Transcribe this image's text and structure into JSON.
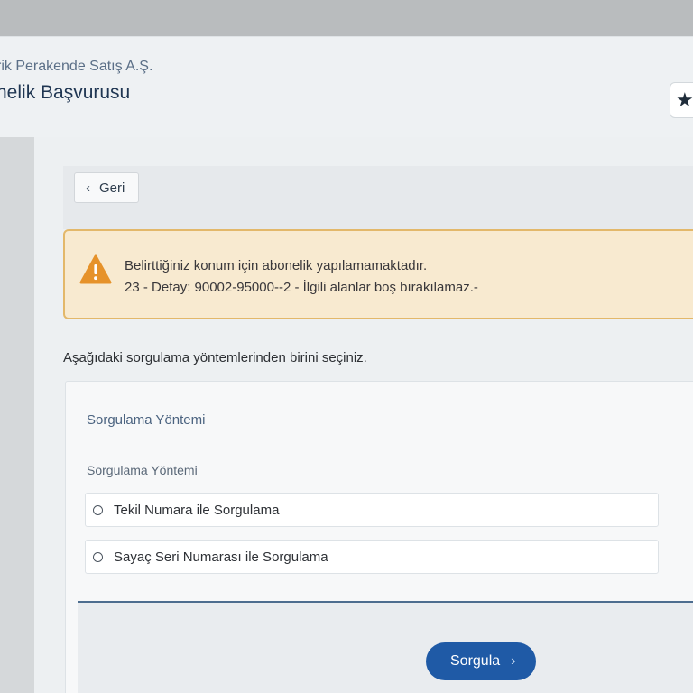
{
  "header": {
    "company": "rik Perakende Satış A.Ş.",
    "app_title": "nelik Başvurusu",
    "favorite_icon": "star-icon"
  },
  "back_button": {
    "label": "Geri",
    "icon": "chevron-left-icon"
  },
  "alert": {
    "icon": "warning-icon",
    "line1": "Belirttiğiniz konum için abonelik yapılamamaktadır.",
    "line2": "23 - Detay: 90002-95000--2 - İlgili alanlar boş bırakılamaz.-",
    "colors": {
      "background": "#f8ead0",
      "border": "#e3b86a",
      "icon": "#e6922a"
    }
  },
  "instruction": "Aşağıdaki sorgulama yöntemlerinden birini seçiniz.",
  "query_card": {
    "title": "Sorgulama Yöntemi",
    "field_label": "Sorgulama Yöntemi",
    "options": [
      {
        "label": "Tekil Numara ile Sorgulama",
        "selected": false
      },
      {
        "label": "Sayaç Seri Numarası ile Sorgulama",
        "selected": false
      }
    ]
  },
  "submit_button": {
    "label": "Sorgula",
    "icon": "chevron-right-icon",
    "color": "#1f5aa6"
  }
}
